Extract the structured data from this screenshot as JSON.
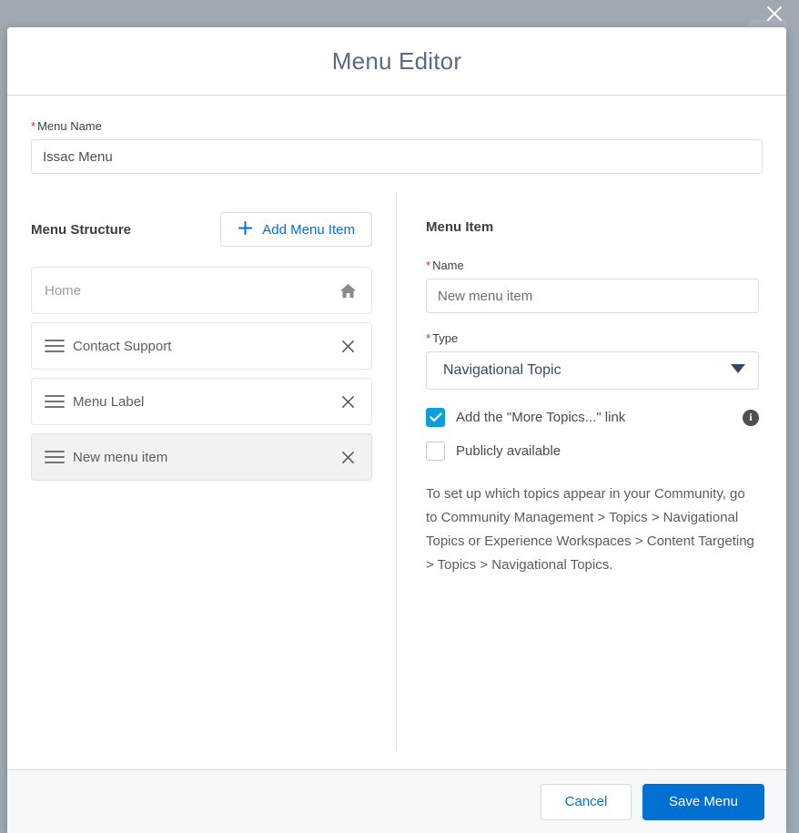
{
  "modal": {
    "title": "Menu Editor",
    "close_icon": "close-icon"
  },
  "menu_name": {
    "label": "Menu Name",
    "required_marker": "*",
    "value": "Issac Menu"
  },
  "structure": {
    "heading": "Menu Structure",
    "add_button": {
      "label": "Add Menu Item",
      "icon": "plus-icon"
    },
    "items": [
      {
        "label": "Home",
        "icon": "home-icon",
        "draggable": false,
        "removable": false,
        "selected": false,
        "muted": true
      },
      {
        "label": "Contact Support",
        "icon": "close-icon",
        "draggable": true,
        "removable": true,
        "selected": false,
        "muted": false
      },
      {
        "label": "Menu Label",
        "icon": "close-icon",
        "draggable": true,
        "removable": true,
        "selected": false,
        "muted": false
      },
      {
        "label": "New menu item",
        "icon": "close-icon",
        "draggable": true,
        "removable": true,
        "selected": true,
        "muted": false
      }
    ]
  },
  "menu_item": {
    "heading": "Menu Item",
    "name": {
      "label": "Name",
      "required_marker": "*",
      "value": "New menu item"
    },
    "type": {
      "label": "Type",
      "required_marker": "*",
      "value": "Navigational Topic",
      "options": [
        "Navigational Topic"
      ],
      "arrow_icon": "chevron-down-icon"
    },
    "more_topics": {
      "label": "Add the \"More Topics...\" link",
      "checked": true,
      "info_icon": "info-icon",
      "info_glyph": "i"
    },
    "publicly_available": {
      "label": "Publicly available",
      "checked": false
    },
    "help_text": "To set up which topics appear in your Community, go to Community Management > Topics > Navigational Topics or Experience Workspaces > Content Targeting > Topics > Navigational Topics."
  },
  "footer": {
    "cancel_label": "Cancel",
    "save_label": "Save Menu"
  },
  "colors": {
    "brand_blue": "#0070d2",
    "checkbox_blue": "#0d9dda",
    "required_red": "#c23934",
    "backdrop": "#9ea9b2",
    "title_slate": "#5a6a83"
  }
}
